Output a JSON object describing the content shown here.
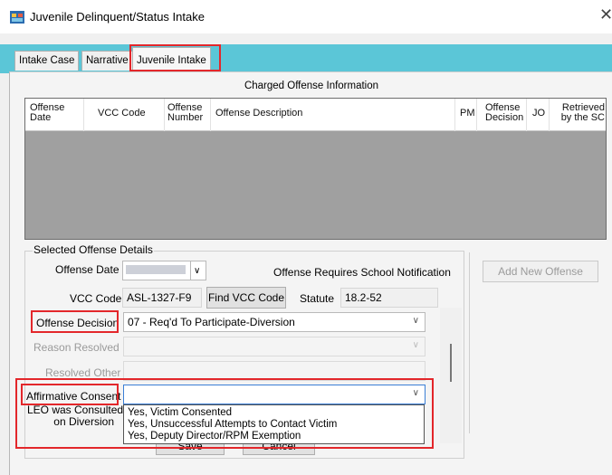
{
  "window": {
    "title": "Juvenile Delinquent/Status Intake",
    "close_glyph": "✕"
  },
  "tabs": [
    {
      "label": "Intake Case"
    },
    {
      "label": "Narrative"
    },
    {
      "label": "Juvenile Intake",
      "active": true
    }
  ],
  "charged_offense": {
    "title": "Charged Offense Information",
    "columns": [
      "Offense\nDate",
      "VCC Code",
      "Offense\nNumber",
      "Offense Description",
      "PM",
      "Offense\nDecision",
      "JO",
      "Retrieved\nby the SC"
    ],
    "rows": []
  },
  "details": {
    "group_title": "Selected Offense Details",
    "offense_date_label": "Offense Date",
    "offense_requires_school_label": "Offense Requires School Notification",
    "vcc_code_label": "VCC Code",
    "vcc_code_value": "ASL-1327-F9",
    "find_vcc_button": "Find VCC Code",
    "statute_label": "Statute",
    "statute_value": "18.2-52",
    "offense_decision_label": "Offense Decision",
    "offense_decision_value": "07 - Req'd To Participate-Diversion",
    "reason_resolved_label": "Reason Resolved",
    "resolved_other_label": "Resolved Other",
    "affirmative_consent_label": "Affirmative Consent",
    "affirmative_consent_value": "",
    "leo_consulted_label_line1": "LEO was Consulted",
    "leo_consulted_label_line2": "on Diversion",
    "affirmative_options": [
      "Yes, Victim Consented",
      "Yes, Unsuccessful Attempts to Contact Victim",
      "Yes, Deputy Director/RPM Exemption"
    ],
    "save_button": "Save",
    "cancel_button": "Cancel"
  },
  "add_new_offense_button": "Add New Offense",
  "colors": {
    "tabstrip": "#5bc6d7",
    "highlight_box": "#e3272b",
    "grid_empty": "#a0a0a0"
  },
  "icons": [
    "app-icon",
    "close-icon",
    "chevron-down-icon",
    "calendar-dropdown-icon"
  ]
}
